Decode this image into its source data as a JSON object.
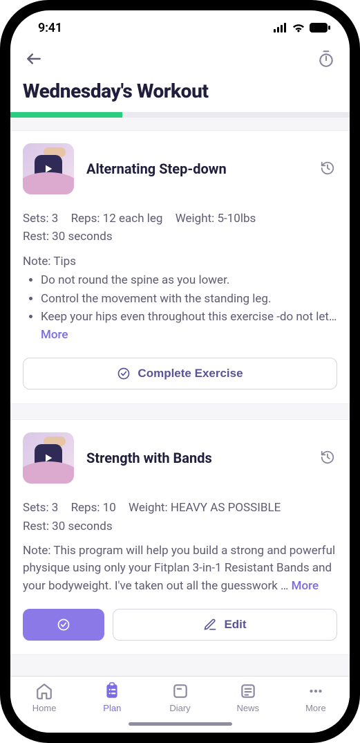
{
  "status": {
    "time": "9:41"
  },
  "header": {
    "title": "Wednesday's Workout"
  },
  "progress": {
    "percent": 33
  },
  "exercises": [
    {
      "title": "Alternating Step-down",
      "sets": "Sets: 3",
      "reps": "Reps: 12 each leg",
      "weight": "Weight: 5-10lbs",
      "rest": "Rest: 30 seconds",
      "note_label": "Note: Tips",
      "tips": [
        "Do not round the spine as you lower.",
        "Control the movement with the standing leg.",
        "Keep your hips even throughout this exercise -do not let… "
      ],
      "more": "More",
      "complete_label": "Complete Exercise"
    },
    {
      "title": "Strength with Bands",
      "sets": "Sets: 3",
      "reps": "Reps: 10",
      "weight": "Weight: HEAVY AS POSSIBLE",
      "rest": "Rest: 30 seconds",
      "note_para": "Note: This program will help you build a strong and powerful physique using only your Fitplan 3-in-1 Resistant Bands and your bodyweight. I've taken out all the guesswork … ",
      "more": "More",
      "edit_label": "Edit"
    }
  ],
  "tabs": {
    "home": "Home",
    "plan": "Plan",
    "diary": "Diary",
    "news": "News",
    "more": "More"
  }
}
